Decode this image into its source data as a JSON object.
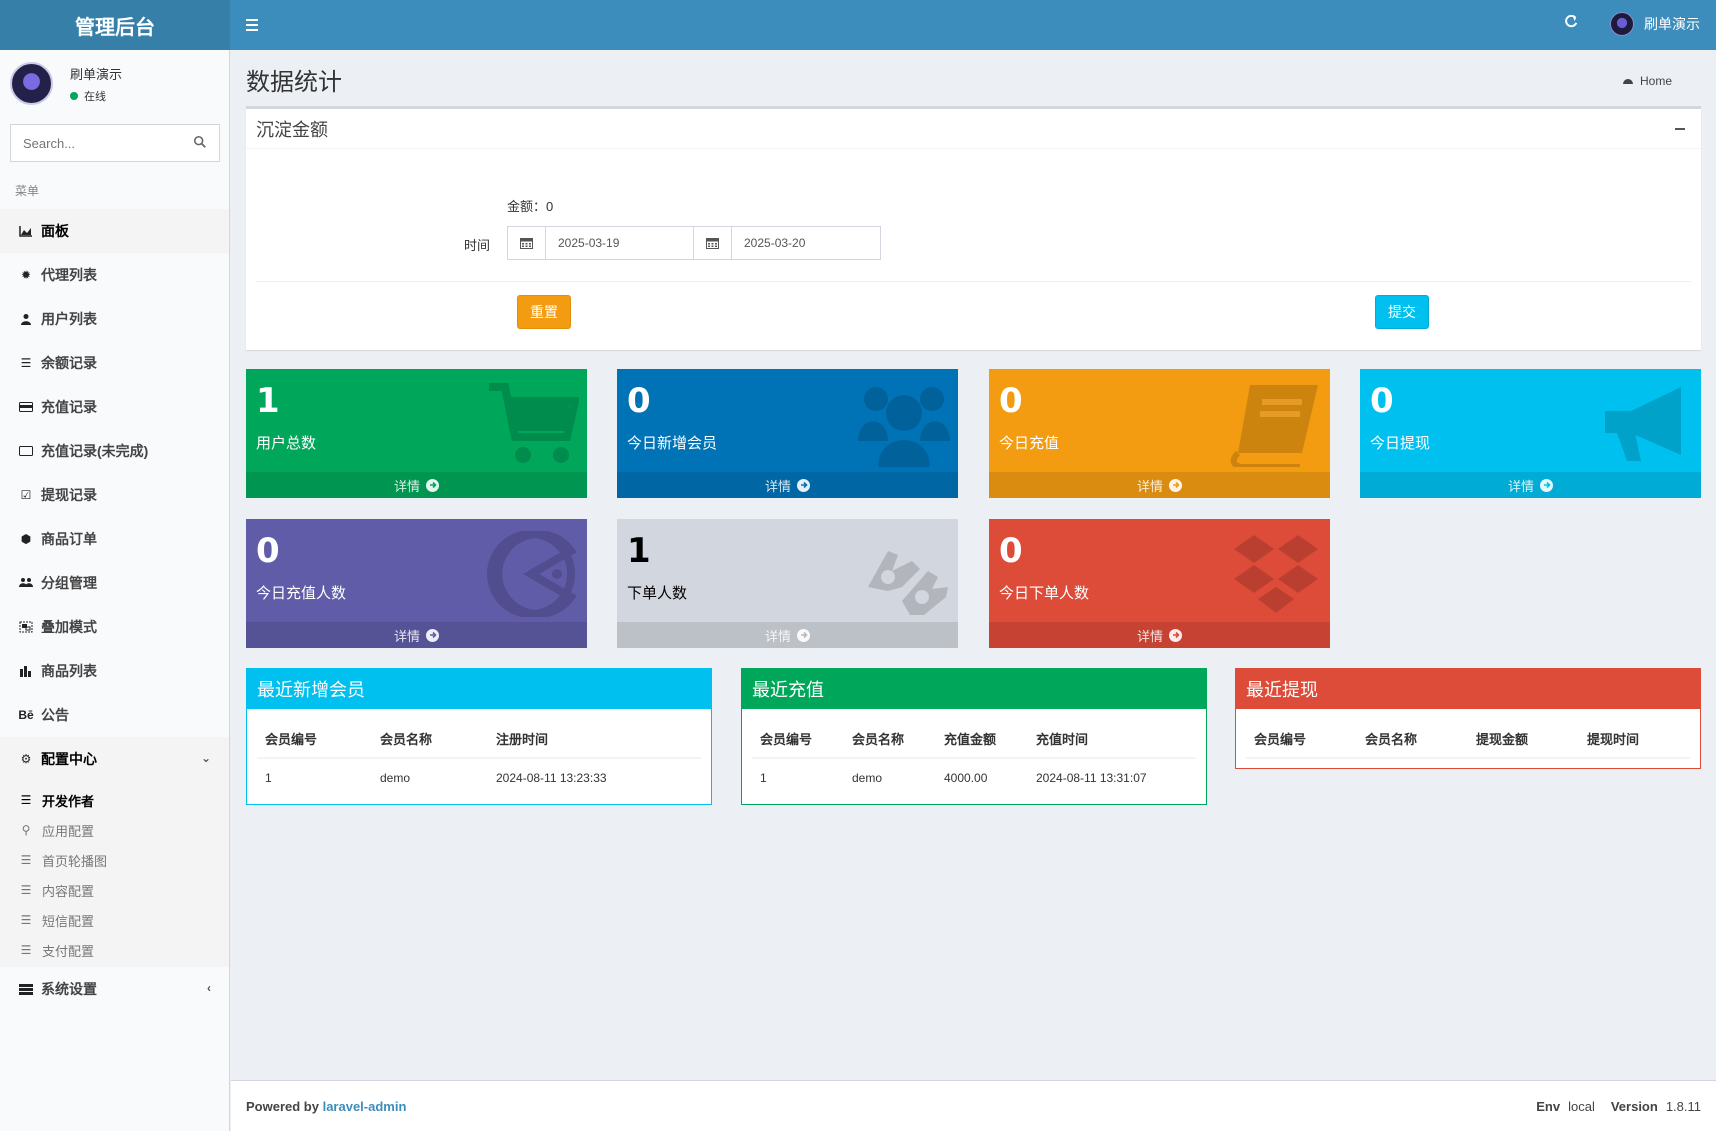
{
  "header": {
    "logo": "管理后台",
    "user_name": "刷单演示"
  },
  "sidebar": {
    "user_name": "刷单演示",
    "status": "在线",
    "search_placeholder": "Search...",
    "menu_header": "菜单",
    "items": [
      {
        "label": "面板",
        "icon": "area-chart-icon"
      },
      {
        "label": "代理列表",
        "icon": "gear-icon"
      },
      {
        "label": "用户列表",
        "icon": "user-icon"
      },
      {
        "label": "余额记录",
        "icon": "list-icon"
      },
      {
        "label": "充值记录",
        "icon": "credit-card-icon"
      },
      {
        "label": "充值记录(未完成)",
        "icon": "card-outline-icon"
      },
      {
        "label": "提现记录",
        "icon": "check-square-icon"
      },
      {
        "label": "商品订单",
        "icon": "cube-icon"
      },
      {
        "label": "分组管理",
        "icon": "users-icon"
      },
      {
        "label": "叠加模式",
        "icon": "object-group-icon"
      },
      {
        "label": "商品列表",
        "icon": "bar-chart-icon"
      },
      {
        "label": "公告",
        "icon": "behance-icon"
      }
    ],
    "config_center": {
      "label": "配置中心",
      "sub_items": [
        {
          "label": "开发作者",
          "icon": "bars-icon"
        },
        {
          "label": "应用配置",
          "icon": "link-icon"
        },
        {
          "label": "首页轮播图",
          "icon": "bars-icon"
        },
        {
          "label": "内容配置",
          "icon": "bars-icon"
        },
        {
          "label": "短信配置",
          "icon": "bars-icon"
        },
        {
          "label": "支付配置",
          "icon": "bars-icon"
        }
      ]
    },
    "system_settings": {
      "label": "系统设置"
    }
  },
  "content": {
    "title": "数据统计",
    "breadcrumb": "Home"
  },
  "deposit_box": {
    "title": "沉淀金额",
    "amount_label": "金额：",
    "amount_value": "0",
    "time_label": "时间",
    "start_date": "2025-03-19",
    "end_date": "2025-03-20",
    "reset_label": "重置",
    "submit_label": "提交"
  },
  "stats": [
    {
      "value": "1",
      "label": "用户总数",
      "footer": "详情",
      "color": "#00a65a",
      "icon": "shopping-cart-icon"
    },
    {
      "value": "0",
      "label": "今日新增会员",
      "footer": "详情",
      "color": "#0073b7",
      "icon": "users-icon"
    },
    {
      "value": "0",
      "label": "今日充值",
      "footer": "详情",
      "color": "#f39c12",
      "icon": "book-icon"
    },
    {
      "value": "0",
      "label": "今日提现",
      "footer": "详情",
      "color": "#00c0ef",
      "icon": "bullhorn-icon"
    },
    {
      "value": "0",
      "label": "今日充值人数",
      "footer": "详情",
      "color": "#605ca8",
      "icon": "pacman-icon"
    },
    {
      "value": "1",
      "label": "下单人数",
      "footer": "详情",
      "color": "#d2d6de",
      "icon": "sign-language-icon"
    },
    {
      "value": "0",
      "label": "今日下单人数",
      "footer": "详情",
      "color": "#dd4b39",
      "icon": "dropbox-icon"
    }
  ],
  "recent_members": {
    "title": "最近新增会员",
    "columns": [
      "会员编号",
      "会员名称",
      "注册时间"
    ],
    "rows": [
      [
        "1",
        "demo",
        "2024-08-11 13:23:33"
      ]
    ]
  },
  "recent_recharge": {
    "title": "最近充值",
    "columns": [
      "会员编号",
      "会员名称",
      "充值金额",
      "充值时间"
    ],
    "rows": [
      [
        "1",
        "demo",
        "4000.00",
        "2024-08-11 13:31:07"
      ]
    ]
  },
  "recent_withdraw": {
    "title": "最近提现",
    "columns": [
      "会员编号",
      "会员名称",
      "提现金额",
      "提现时间"
    ],
    "rows": []
  },
  "footer": {
    "powered_by": "Powered by",
    "link": "laravel-admin",
    "env_label": "Env",
    "env_value": "local",
    "version_label": "Version",
    "version_value": "1.8.11"
  }
}
